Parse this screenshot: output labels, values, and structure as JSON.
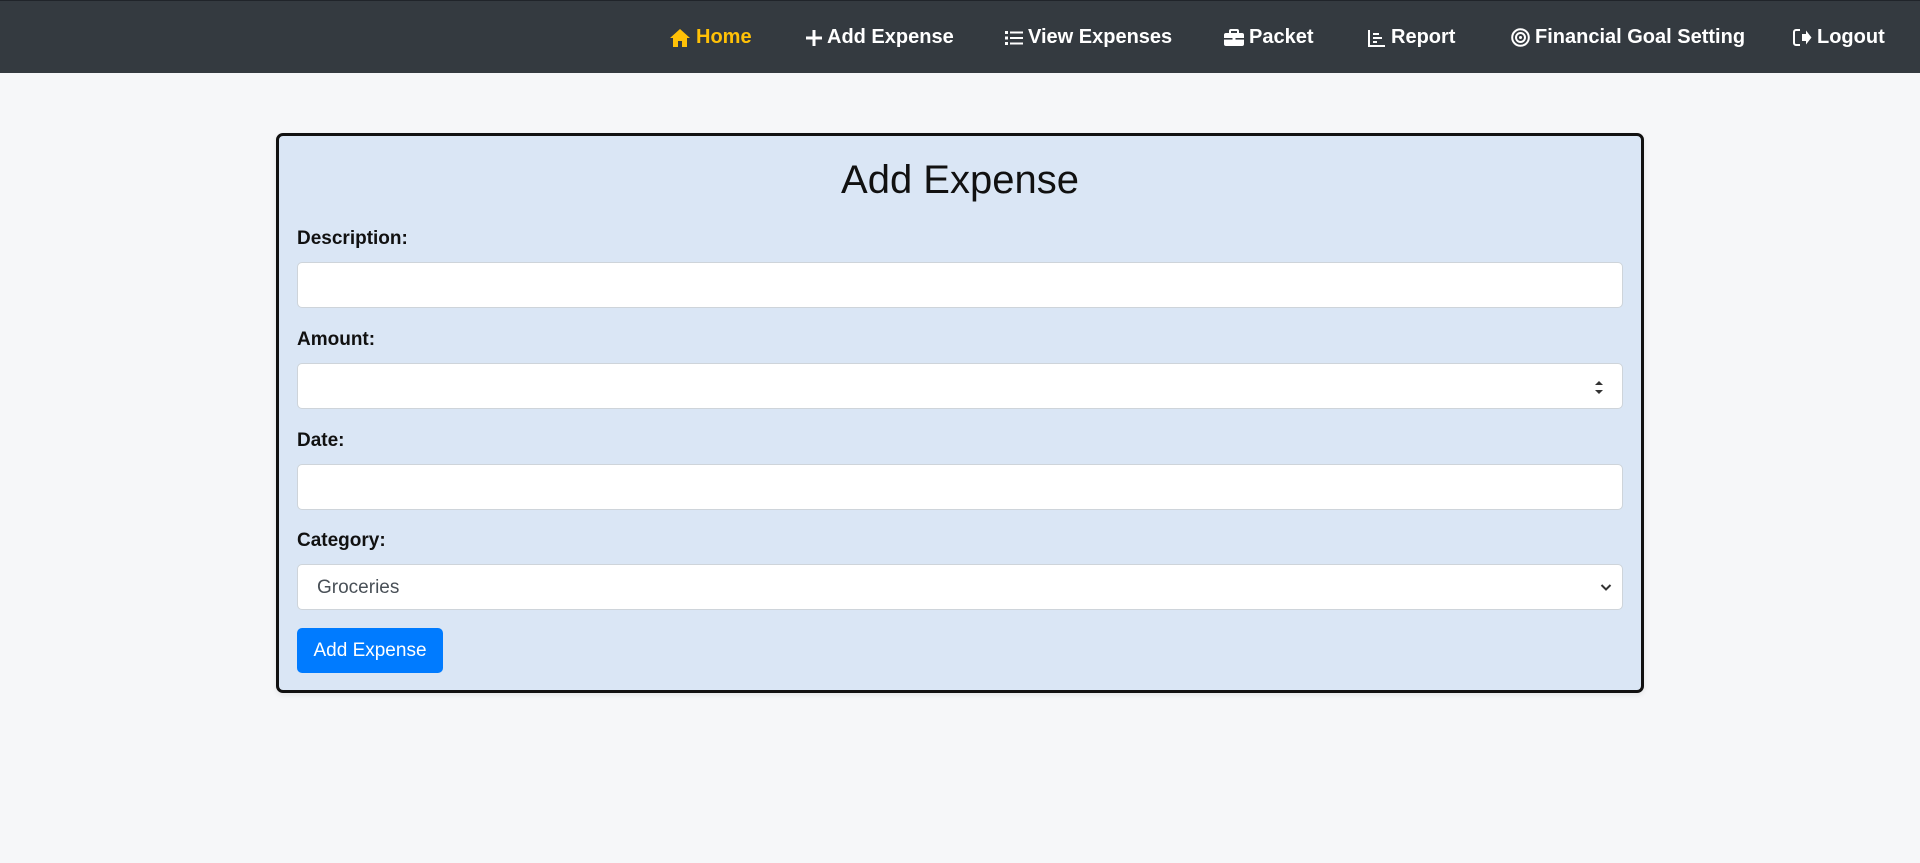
{
  "nav": {
    "items": [
      {
        "label": "Home",
        "icon": "home-icon",
        "active": true
      },
      {
        "label": "Add Expense",
        "icon": "plus-icon"
      },
      {
        "label": "View Expenses",
        "icon": "list-icon"
      },
      {
        "label": "Packet",
        "icon": "briefcase-icon"
      },
      {
        "label": "Report",
        "icon": "chart-icon"
      },
      {
        "label": "Financial Goal Setting",
        "icon": "target-icon"
      },
      {
        "label": "Logout",
        "icon": "logout-icon"
      }
    ],
    "active_color": "#ffc107",
    "background": "#343a40"
  },
  "form": {
    "title": "Add Expense",
    "description_label": "Description:",
    "description_value": "",
    "amount_label": "Amount:",
    "amount_value": "",
    "date_label": "Date:",
    "date_value": "",
    "category_label": "Category:",
    "category_selected": "Groceries",
    "submit_label": "Add Expense",
    "card_color": "#dae6f5",
    "button_color": "#007bff"
  }
}
